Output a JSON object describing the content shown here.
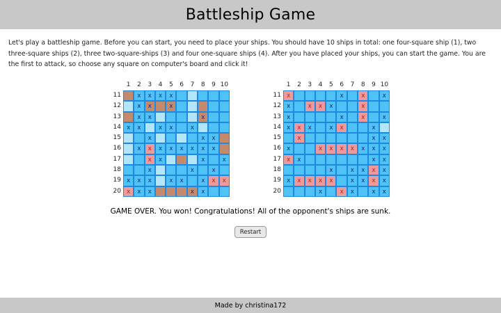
{
  "header": {
    "title": "Battleship Game"
  },
  "intro": {
    "text": "Let's play a battleship game. Before you can start, you need to place your ships. You should have 10 ships in total: one four-square ship (1), two three-square ships (2), three two-square-ships (3) and four one-square ships (4). After you have placed your ships, you can start the game. You are the first to attack, so choose any square on computer's board and click it!"
  },
  "boards": {
    "player": {
      "columns": [
        "1",
        "2",
        "3",
        "4",
        "5",
        "6",
        "7",
        "8",
        "9",
        "10"
      ],
      "rows": [
        "11",
        "12",
        "13",
        "14",
        "15",
        "16",
        "17",
        "18",
        "19",
        "20"
      ],
      "cells": [
        [
          {
            "t": "s",
            "m": ""
          },
          {
            "t": "w",
            "m": "x"
          },
          {
            "t": "w",
            "m": "x"
          },
          {
            "t": "w",
            "m": "x"
          },
          {
            "t": "w",
            "m": "x"
          },
          {
            "t": "w",
            "m": ""
          },
          {
            "t": "l",
            "m": ""
          },
          {
            "t": "w",
            "m": ""
          },
          {
            "t": "w",
            "m": ""
          },
          {
            "t": "w",
            "m": ""
          }
        ],
        [
          {
            "t": "l",
            "m": ""
          },
          {
            "t": "w",
            "m": "x"
          },
          {
            "t": "s",
            "m": "x"
          },
          {
            "t": "s",
            "m": ""
          },
          {
            "t": "s",
            "m": "x"
          },
          {
            "t": "w",
            "m": ""
          },
          {
            "t": "l",
            "m": ""
          },
          {
            "t": "s",
            "m": ""
          },
          {
            "t": "w",
            "m": ""
          },
          {
            "t": "w",
            "m": ""
          }
        ],
        [
          {
            "t": "s",
            "m": ""
          },
          {
            "t": "w",
            "m": "x"
          },
          {
            "t": "w",
            "m": "x"
          },
          {
            "t": "l",
            "m": ""
          },
          {
            "t": "w",
            "m": ""
          },
          {
            "t": "w",
            "m": ""
          },
          {
            "t": "l",
            "m": ""
          },
          {
            "t": "s",
            "m": "x"
          },
          {
            "t": "w",
            "m": ""
          },
          {
            "t": "w",
            "m": ""
          }
        ],
        [
          {
            "t": "w",
            "m": "x"
          },
          {
            "t": "w",
            "m": "x"
          },
          {
            "t": "l",
            "m": ""
          },
          {
            "t": "w",
            "m": "x"
          },
          {
            "t": "w",
            "m": "x"
          },
          {
            "t": "w",
            "m": ""
          },
          {
            "t": "w",
            "m": "x"
          },
          {
            "t": "l",
            "m": ""
          },
          {
            "t": "w",
            "m": ""
          },
          {
            "t": "w",
            "m": ""
          }
        ],
        [
          {
            "t": "l",
            "m": ""
          },
          {
            "t": "w",
            "m": ""
          },
          {
            "t": "w",
            "m": "x"
          },
          {
            "t": "l",
            "m": ""
          },
          {
            "t": "w",
            "m": ""
          },
          {
            "t": "l",
            "m": ""
          },
          {
            "t": "w",
            "m": ""
          },
          {
            "t": "w",
            "m": "x"
          },
          {
            "t": "w",
            "m": "x"
          },
          {
            "t": "s",
            "m": ""
          }
        ],
        [
          {
            "t": "l",
            "m": ""
          },
          {
            "t": "w",
            "m": "x"
          },
          {
            "t": "h",
            "m": "x"
          },
          {
            "t": "w",
            "m": "x"
          },
          {
            "t": "w",
            "m": "x"
          },
          {
            "t": "w",
            "m": "x"
          },
          {
            "t": "w",
            "m": "x"
          },
          {
            "t": "w",
            "m": "x"
          },
          {
            "t": "w",
            "m": "x"
          },
          {
            "t": "s",
            "m": ""
          }
        ],
        [
          {
            "t": "l",
            "m": ""
          },
          {
            "t": "w",
            "m": ""
          },
          {
            "t": "h",
            "m": "x"
          },
          {
            "t": "w",
            "m": "x"
          },
          {
            "t": "l",
            "m": ""
          },
          {
            "t": "s",
            "m": ""
          },
          {
            "t": "l",
            "m": ""
          },
          {
            "t": "w",
            "m": "x"
          },
          {
            "t": "w",
            "m": ""
          },
          {
            "t": "w",
            "m": "x"
          }
        ],
        [
          {
            "t": "w",
            "m": ""
          },
          {
            "t": "w",
            "m": ""
          },
          {
            "t": "w",
            "m": "x"
          },
          {
            "t": "l",
            "m": ""
          },
          {
            "t": "w",
            "m": ""
          },
          {
            "t": "w",
            "m": ""
          },
          {
            "t": "w",
            "m": "x"
          },
          {
            "t": "w",
            "m": ""
          },
          {
            "t": "w",
            "m": "x"
          },
          {
            "t": "w",
            "m": ""
          }
        ],
        [
          {
            "t": "w",
            "m": "x"
          },
          {
            "t": "w",
            "m": "x"
          },
          {
            "t": "w",
            "m": "x"
          },
          {
            "t": "l",
            "m": ""
          },
          {
            "t": "w",
            "m": "x"
          },
          {
            "t": "w",
            "m": "x"
          },
          {
            "t": "w",
            "m": ""
          },
          {
            "t": "w",
            "m": "x"
          },
          {
            "t": "h",
            "m": "x"
          },
          {
            "t": "h",
            "m": "x"
          }
        ],
        [
          {
            "t": "h",
            "m": "x"
          },
          {
            "t": "w",
            "m": "x"
          },
          {
            "t": "w",
            "m": "x"
          },
          {
            "t": "s",
            "m": ""
          },
          {
            "t": "s",
            "m": ""
          },
          {
            "t": "s",
            "m": ""
          },
          {
            "t": "s",
            "m": "x"
          },
          {
            "t": "w",
            "m": "x"
          },
          {
            "t": "w",
            "m": ""
          },
          {
            "t": "w",
            "m": ""
          }
        ]
      ]
    },
    "computer": {
      "columns": [
        "1",
        "2",
        "3",
        "4",
        "5",
        "6",
        "7",
        "8",
        "9",
        "10"
      ],
      "rows": [
        "11",
        "12",
        "13",
        "14",
        "15",
        "16",
        "17",
        "18",
        "19",
        "20"
      ],
      "cells": [
        [
          {
            "t": "h",
            "m": "x"
          },
          {
            "t": "w",
            "m": ""
          },
          {
            "t": "w",
            "m": ""
          },
          {
            "t": "w",
            "m": ""
          },
          {
            "t": "w",
            "m": ""
          },
          {
            "t": "w",
            "m": "x"
          },
          {
            "t": "w",
            "m": ""
          },
          {
            "t": "h",
            "m": "x"
          },
          {
            "t": "w",
            "m": ""
          },
          {
            "t": "w",
            "m": "x"
          }
        ],
        [
          {
            "t": "w",
            "m": "x"
          },
          {
            "t": "w",
            "m": ""
          },
          {
            "t": "h",
            "m": "x"
          },
          {
            "t": "h",
            "m": "x"
          },
          {
            "t": "w",
            "m": "x"
          },
          {
            "t": "w",
            "m": ""
          },
          {
            "t": "w",
            "m": ""
          },
          {
            "t": "h",
            "m": "x"
          },
          {
            "t": "w",
            "m": ""
          },
          {
            "t": "w",
            "m": ""
          }
        ],
        [
          {
            "t": "w",
            "m": "x"
          },
          {
            "t": "w",
            "m": ""
          },
          {
            "t": "w",
            "m": ""
          },
          {
            "t": "w",
            "m": ""
          },
          {
            "t": "w",
            "m": ""
          },
          {
            "t": "w",
            "m": "x"
          },
          {
            "t": "w",
            "m": ""
          },
          {
            "t": "h",
            "m": "x"
          },
          {
            "t": "w",
            "m": ""
          },
          {
            "t": "w",
            "m": "x"
          }
        ],
        [
          {
            "t": "w",
            "m": "x"
          },
          {
            "t": "h",
            "m": "x"
          },
          {
            "t": "w",
            "m": "x"
          },
          {
            "t": "w",
            "m": ""
          },
          {
            "t": "w",
            "m": "x"
          },
          {
            "t": "h",
            "m": "x"
          },
          {
            "t": "w",
            "m": ""
          },
          {
            "t": "w",
            "m": ""
          },
          {
            "t": "w",
            "m": "x"
          },
          {
            "t": "l",
            "m": ""
          }
        ],
        [
          {
            "t": "w",
            "m": ""
          },
          {
            "t": "h",
            "m": "x"
          },
          {
            "t": "w",
            "m": ""
          },
          {
            "t": "w",
            "m": ""
          },
          {
            "t": "w",
            "m": ""
          },
          {
            "t": "w",
            "m": ""
          },
          {
            "t": "w",
            "m": ""
          },
          {
            "t": "w",
            "m": ""
          },
          {
            "t": "w",
            "m": "x"
          },
          {
            "t": "w",
            "m": "x"
          }
        ],
        [
          {
            "t": "w",
            "m": "x"
          },
          {
            "t": "w",
            "m": ""
          },
          {
            "t": "w",
            "m": ""
          },
          {
            "t": "h",
            "m": "x"
          },
          {
            "t": "h",
            "m": "x"
          },
          {
            "t": "h",
            "m": "x"
          },
          {
            "t": "h",
            "m": "x"
          },
          {
            "t": "w",
            "m": "x"
          },
          {
            "t": "w",
            "m": "x"
          },
          {
            "t": "w",
            "m": "x"
          }
        ],
        [
          {
            "t": "h",
            "m": "x"
          },
          {
            "t": "w",
            "m": "x"
          },
          {
            "t": "w",
            "m": ""
          },
          {
            "t": "w",
            "m": ""
          },
          {
            "t": "w",
            "m": ""
          },
          {
            "t": "w",
            "m": ""
          },
          {
            "t": "w",
            "m": ""
          },
          {
            "t": "w",
            "m": ""
          },
          {
            "t": "w",
            "m": "x"
          },
          {
            "t": "w",
            "m": "x"
          }
        ],
        [
          {
            "t": "w",
            "m": ""
          },
          {
            "t": "w",
            "m": ""
          },
          {
            "t": "w",
            "m": ""
          },
          {
            "t": "w",
            "m": ""
          },
          {
            "t": "w",
            "m": "x"
          },
          {
            "t": "w",
            "m": ""
          },
          {
            "t": "w",
            "m": "x"
          },
          {
            "t": "w",
            "m": "x"
          },
          {
            "t": "h",
            "m": "x"
          },
          {
            "t": "w",
            "m": "x"
          }
        ],
        [
          {
            "t": "w",
            "m": "x"
          },
          {
            "t": "h",
            "m": "x"
          },
          {
            "t": "h",
            "m": "x"
          },
          {
            "t": "h",
            "m": "x"
          },
          {
            "t": "h",
            "m": "x"
          },
          {
            "t": "w",
            "m": ""
          },
          {
            "t": "w",
            "m": "x"
          },
          {
            "t": "w",
            "m": "x"
          },
          {
            "t": "h",
            "m": "x"
          },
          {
            "t": "w",
            "m": "x"
          }
        ],
        [
          {
            "t": "w",
            "m": ""
          },
          {
            "t": "w",
            "m": ""
          },
          {
            "t": "w",
            "m": ""
          },
          {
            "t": "w",
            "m": "x"
          },
          {
            "t": "w",
            "m": ""
          },
          {
            "t": "h",
            "m": "x"
          },
          {
            "t": "w",
            "m": "x"
          },
          {
            "t": "w",
            "m": ""
          },
          {
            "t": "w",
            "m": "x"
          },
          {
            "t": "w",
            "m": "x"
          }
        ]
      ]
    }
  },
  "status": {
    "text": "GAME OVER. You won! Congratulations! All of the opponent's ships are sunk."
  },
  "controls": {
    "restart_label": "Restart"
  },
  "footer": {
    "text": "Made by christina172"
  },
  "colors": {
    "water": "#4fc3f7",
    "water_light": "#b3e5fc",
    "ship": "#c48a6c",
    "hit": "#ef9a9a",
    "grid_line": "#1e88e5"
  }
}
